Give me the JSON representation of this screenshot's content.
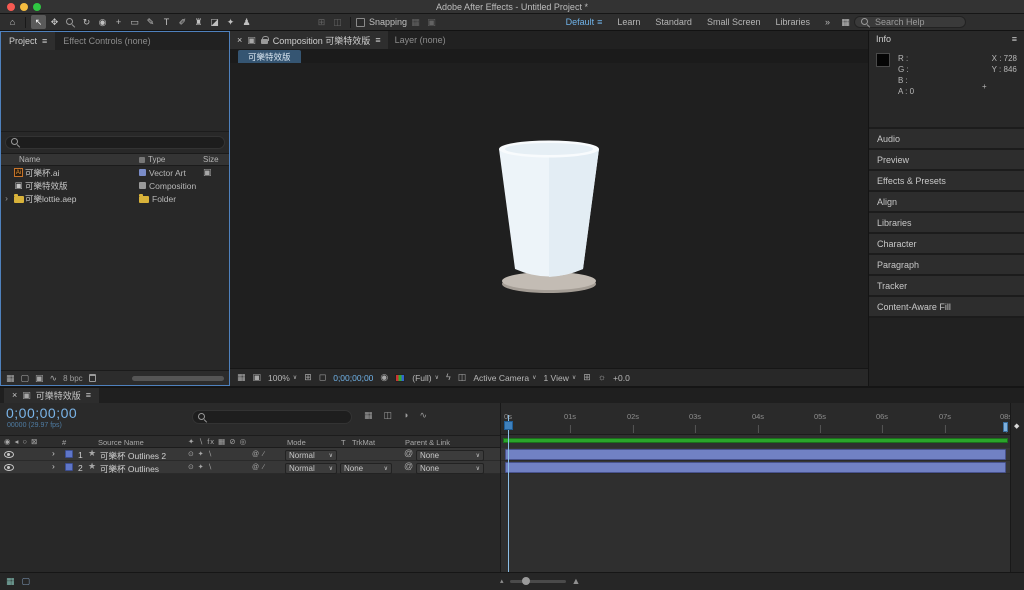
{
  "titlebar": {
    "title": "Adobe After Effects - Untitled Project *"
  },
  "toolbar": {
    "snapping": "Snapping",
    "workspaces": [
      "Default",
      "Learn",
      "Standard",
      "Small Screen",
      "Libraries"
    ],
    "overflow": "»",
    "search_placeholder": "Search Help"
  },
  "project": {
    "tab_project": "Project",
    "tab_effect_controls": "Effect Controls (none)",
    "col_name": "Name",
    "col_type": "Type",
    "col_size": "Size",
    "items": [
      {
        "name": "可樂杯.ai",
        "type": "Vector Art"
      },
      {
        "name": "可樂特效版",
        "type": "Composition"
      },
      {
        "name": "可樂lottie.aep",
        "type": "Folder"
      }
    ],
    "bpc": "8 bpc"
  },
  "comp": {
    "tab_main": "Composition 可樂特效版",
    "tab_layer": "Layer (none)",
    "viewer_tab": "可樂特效版",
    "zoom": "100%",
    "timecode": "0;00;00;00",
    "resolution": "(Full)",
    "camera": "Active Camera",
    "view": "1 View",
    "exposure": "+0.0"
  },
  "info": {
    "title": "Info",
    "r": "R :",
    "g": "G :",
    "b": "B :",
    "a": "A :  0",
    "x": "X :  728",
    "y": "Y :  846"
  },
  "panels": [
    "Audio",
    "Preview",
    "Effects & Presets",
    "Align",
    "Libraries",
    "Character",
    "Paragraph",
    "Tracker",
    "Content-Aware Fill"
  ],
  "timeline": {
    "tab": "可樂特效版",
    "timecode": "0;00;00;00",
    "frames": "00000 (29.97 fps)",
    "col_hash": "#",
    "col_source": "Source Name",
    "col_mode": "Mode",
    "col_trkmat_t": "T",
    "col_trkmat": "TrkMat",
    "col_parent": "Parent & Link",
    "ruler": [
      "0s",
      "01s",
      "02s",
      "03s",
      "04s",
      "05s",
      "06s",
      "07s",
      "08s"
    ],
    "layers": [
      {
        "index": "1",
        "name": "可樂杯 Outlines 2",
        "mode": "Normal",
        "parent": "None"
      },
      {
        "index": "2",
        "name": "可樂杯 Outlines",
        "mode": "Normal",
        "trkmat": "None",
        "parent": "None"
      }
    ]
  },
  "colors": {
    "focus_border_blue": "#4f81bd",
    "timecode_blue": "#6fb2e8",
    "layer_bar_purple": "#7181c4",
    "work_area_green": "#2aa52a",
    "folder_yellow": "#d8b23a"
  }
}
